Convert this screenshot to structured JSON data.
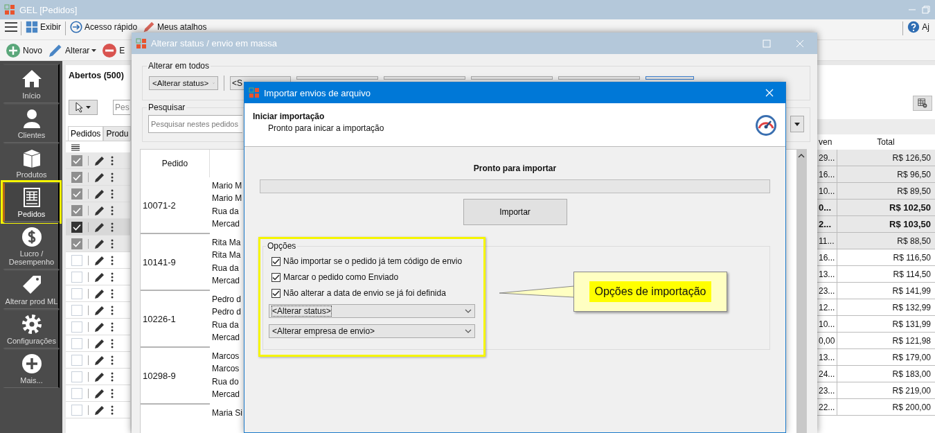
{
  "main_window": {
    "title": "GEL [Pedidos]"
  },
  "toolbar": [
    {
      "label": "Exibir"
    },
    {
      "label": "Acesso rápido"
    },
    {
      "label": "Meus atalhos"
    }
  ],
  "help_label": "Aj",
  "actions": [
    {
      "label": "Novo",
      "kind": "add"
    },
    {
      "label": "Alterar",
      "kind": "edit"
    },
    {
      "label": "E",
      "kind": "remove"
    }
  ],
  "sidebar": {
    "items": [
      {
        "label": "Início",
        "selected": false,
        "highlighted": false
      },
      {
        "label": "Clientes",
        "selected": false,
        "highlighted": false
      },
      {
        "label": "Produtos",
        "selected": false,
        "highlighted": false
      },
      {
        "label": "Pedidos",
        "selected": true,
        "highlighted": true
      },
      {
        "label": "Lucro / Desempenho",
        "selected": false,
        "highlighted": false
      },
      {
        "label": "Alterar prod ML",
        "selected": false,
        "highlighted": false
      },
      {
        "label": "Configurações",
        "selected": false,
        "highlighted": false
      },
      {
        "label": "Mais...",
        "selected": false,
        "highlighted": false
      }
    ]
  },
  "orders_panel": {
    "title": "Abertos (500)",
    "search_placeholder": "Pes",
    "tabs": [
      {
        "label": "Pedidos",
        "selected": true
      },
      {
        "label": "Produ",
        "selected": false
      }
    ],
    "columns": [
      "ven",
      "Total"
    ],
    "rows": [
      {
        "checked": true,
        "selected": false,
        "emphasized": false,
        "column_1": "29...",
        "total": "R$ 126,50"
      },
      {
        "checked": true,
        "selected": false,
        "emphasized": false,
        "column_1": "16...",
        "total": "R$ 96,50"
      },
      {
        "checked": true,
        "selected": false,
        "emphasized": false,
        "column_1": "10...",
        "total": "R$ 89,50"
      },
      {
        "checked": true,
        "selected": false,
        "emphasized": true,
        "column_1": "0...",
        "total": "R$ 102,50"
      },
      {
        "checked": true,
        "selected": true,
        "emphasized": true,
        "column_1": "2...",
        "total": "R$ 103,50"
      },
      {
        "checked": true,
        "selected": false,
        "emphasized": false,
        "column_1": "11...",
        "total": "R$ 88,50"
      },
      {
        "checked": false,
        "selected": false,
        "emphasized": false,
        "column_1": "16...",
        "total": "R$ 116,50"
      },
      {
        "checked": false,
        "selected": false,
        "emphasized": false,
        "column_1": "13...",
        "total": "R$ 114,50"
      },
      {
        "checked": false,
        "selected": false,
        "emphasized": false,
        "column_1": "23...",
        "total": "R$ 141,99"
      },
      {
        "checked": false,
        "selected": false,
        "emphasized": false,
        "column_1": "12...",
        "total": "R$ 132,99"
      },
      {
        "checked": false,
        "selected": false,
        "emphasized": false,
        "column_1": "10...",
        "total": "R$ 131,99"
      },
      {
        "checked": false,
        "selected": false,
        "emphasized": false,
        "column_1": "0,00",
        "total": "R$ 121,98"
      },
      {
        "checked": false,
        "selected": false,
        "emphasized": false,
        "column_1": "13...",
        "total": "R$ 179,00"
      },
      {
        "checked": false,
        "selected": false,
        "emphasized": false,
        "column_1": "24...",
        "total": "R$ 183,00"
      },
      {
        "checked": false,
        "selected": false,
        "emphasized": false,
        "column_1": "23...",
        "total": "R$ 219,00"
      },
      {
        "checked": false,
        "selected": false,
        "emphasized": false,
        "column_1": "22...",
        "total": "R$ 200,00"
      }
    ]
  },
  "bulk_window": {
    "title": "Alterar status / envio em massa",
    "apply_all": {
      "legend": "Alterar em todos",
      "status_combo": "<Alterar status>",
      "combo_2": "<S"
    },
    "search": {
      "legend": "Pesquisar",
      "placeholder": "Pesquisar nestes pedidos"
    },
    "grid": {
      "column": "Pedido",
      "groups": [
        {
          "order": "10071-2",
          "lines": [
            "Mario M",
            "Mario M",
            "Rua da",
            "Mercad"
          ]
        },
        {
          "order": "10141-9",
          "lines": [
            "Rita Ma",
            "Rita Ma",
            "Rua da",
            "Mercad"
          ]
        },
        {
          "order": "10226-1",
          "lines": [
            "Pedro d",
            "Pedro d",
            "Rua da",
            "Mercad"
          ]
        },
        {
          "order": "10298-9",
          "lines": [
            "Marcos",
            "Marcos",
            "Rua do",
            "Mercad"
          ]
        },
        {
          "lines": [
            "Maria Si"
          ]
        }
      ]
    }
  },
  "import_dialog": {
    "title": "Importar envios de arquivo",
    "header_title": "Iniciar importação",
    "header_subtitle": "Pronto para inicar a importação",
    "status": "Pronto para importar",
    "progress": {
      "level": 0
    },
    "import_button": "Importar",
    "options": {
      "legend": "Opções",
      "highlighted": true,
      "checkboxes": [
        {
          "label": "Não importar se o pedido já tem código de envio",
          "checked": true
        },
        {
          "label": "Marcar o pedido como Enviado",
          "checked": true
        },
        {
          "label": "Não alterar a data de envio se já foi definida",
          "checked": true
        }
      ],
      "status_select": "<Alterar status>",
      "company_select": "<Alterar empresa de envio>"
    }
  },
  "callout": {
    "text": "Opções de importação"
  }
}
